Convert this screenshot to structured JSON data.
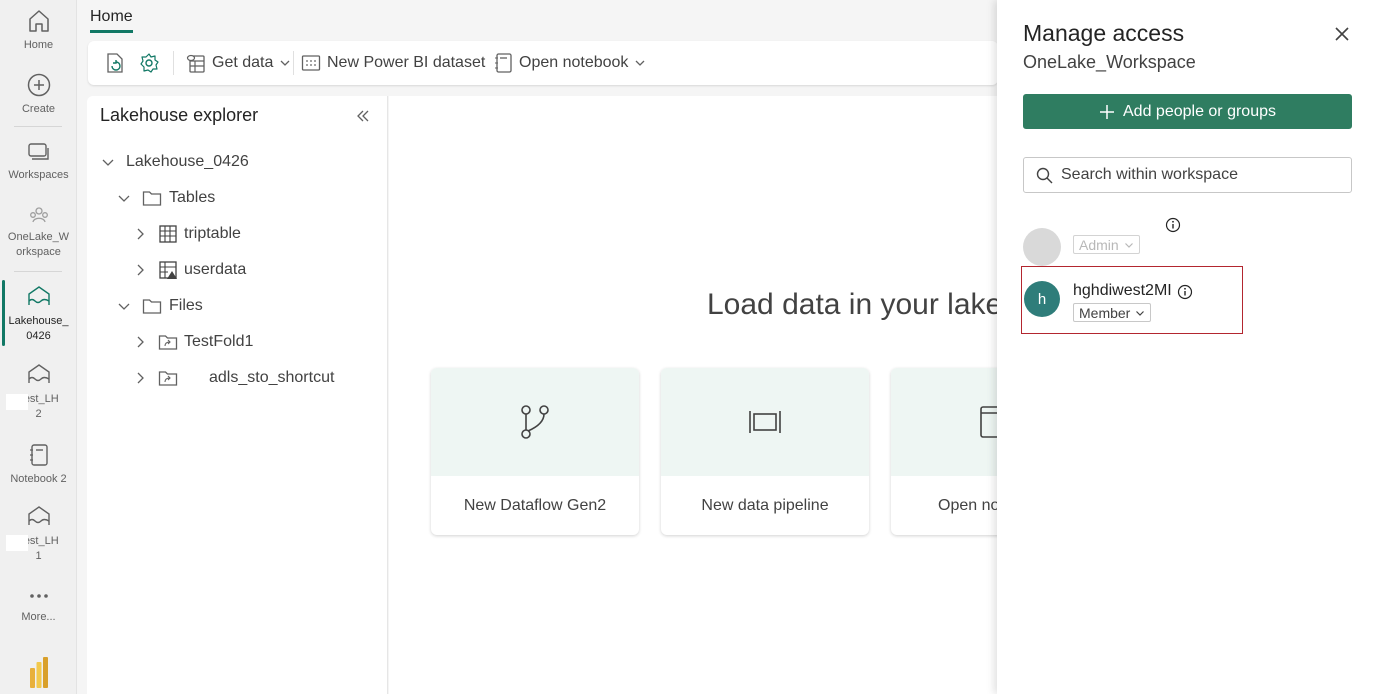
{
  "rail": {
    "items": [
      {
        "label": "Home",
        "icon": "home-icon"
      },
      {
        "label": "Create",
        "icon": "create-plus-icon"
      },
      {
        "label": "Workspaces",
        "icon": "workspaces-icon"
      },
      {
        "label_line1": "OneLake_W",
        "label_line2": "orkspace",
        "icon": "onelake-workspace-icon"
      },
      {
        "label_line1": "Lakehouse_",
        "label_line2": "0426",
        "icon": "lakehouse-icon"
      },
      {
        "label_line1": "Test_LH",
        "label_line2": "2",
        "icon": "lakehouse-icon"
      },
      {
        "label": "Notebook 2",
        "icon": "notebook-icon"
      },
      {
        "label_line1": "Test_LH",
        "label_line2": "1",
        "icon": "lakehouse-icon"
      },
      {
        "label": "More...",
        "icon": "more-ellipsis-icon"
      }
    ]
  },
  "header": {
    "tab": "Home"
  },
  "ribbon": {
    "get_data": "Get data",
    "new_dataset": "New Power BI dataset",
    "open_notebook": "Open notebook"
  },
  "explorer": {
    "title": "Lakehouse explorer",
    "root": "Lakehouse_0426",
    "tables_label": "Tables",
    "tables": [
      "triptable",
      "userdata"
    ],
    "files_label": "Files",
    "files": [
      "TestFold1",
      "adls_sto_shortcut"
    ]
  },
  "canvas": {
    "title": "Load data in your lakeho",
    "cards": [
      "New Dataflow Gen2",
      "New data pipeline",
      "Open no"
    ]
  },
  "panel": {
    "title": "Manage access",
    "subtitle": "OneLake_Workspace",
    "add_button": "Add people or groups",
    "search_placeholder": "Search within workspace",
    "members": [
      {
        "name": "",
        "role": "Admin",
        "avatar": ""
      },
      {
        "name": "hghdiwest2MI",
        "role": "Member",
        "avatar": "h"
      }
    ]
  },
  "colors": {
    "accent": "#117865",
    "add_button": "#2f7d61",
    "highlight_border": "#b3262f",
    "card_top": "#eef6f3"
  }
}
